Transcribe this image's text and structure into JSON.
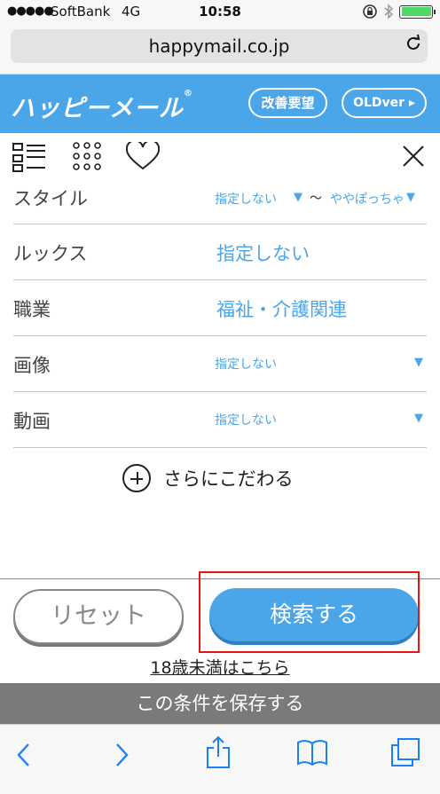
{
  "status_bar": {
    "signal": "●●●●●",
    "carrier": "SoftBank",
    "network": "4G",
    "time": "10:58",
    "icons": [
      "lock-rotation-icon",
      "bluetooth-icon",
      "battery-icon"
    ],
    "battery_level": 1.0
  },
  "browser": {
    "url": "happymail.co.jp"
  },
  "header": {
    "logo": "ハッピーメール",
    "improve_label": "改善要望",
    "old_label": "OLDver ▸"
  },
  "toolbar": {
    "icons": [
      "list-view-icon",
      "grid-view-icon",
      "heart-icon",
      "close-icon"
    ]
  },
  "rows": [
    {
      "label": "スタイル",
      "value": "指定しない",
      "value_to": "ややぽっちゃ"
    },
    {
      "label": "ルックス",
      "value": "指定しない"
    },
    {
      "label": "職業",
      "value": "福祉・介護関連"
    },
    {
      "label": "画像",
      "value": "指定しない"
    },
    {
      "label": "動画",
      "value": "指定しない"
    }
  ],
  "range_separator": "〜",
  "more_label": "さらにこだわる",
  "buttons": {
    "reset": "リセット",
    "search": "検索する"
  },
  "under18_link": "18歳未満はこちら",
  "save_condition": "この条件を保存する",
  "colors": {
    "accent": "#4aa6e9",
    "highlight": "#e11111",
    "save_bar": "#7a7a7a"
  }
}
